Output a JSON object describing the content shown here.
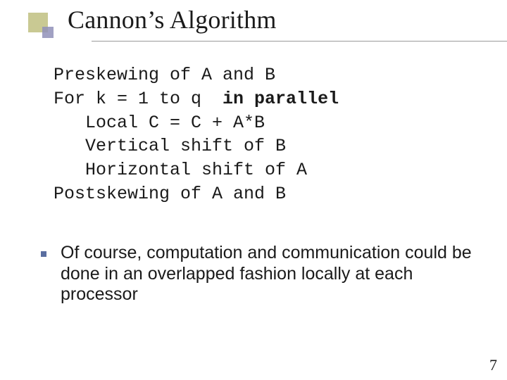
{
  "title": "Cannon’s Algorithm",
  "code": {
    "l1": "Preskewing of A and B",
    "l2a": "For k = 1 to q  ",
    "l2b": "in parallel",
    "l3": "   Local C = C + A*B",
    "l4": "   Vertical shift of B",
    "l5": "   Horizontal shift of A",
    "l6": "Postskewing of A and B"
  },
  "bullet": "Of course, computation and communication could be done in an overlapped fashion locally at each processor",
  "page_number": "7"
}
